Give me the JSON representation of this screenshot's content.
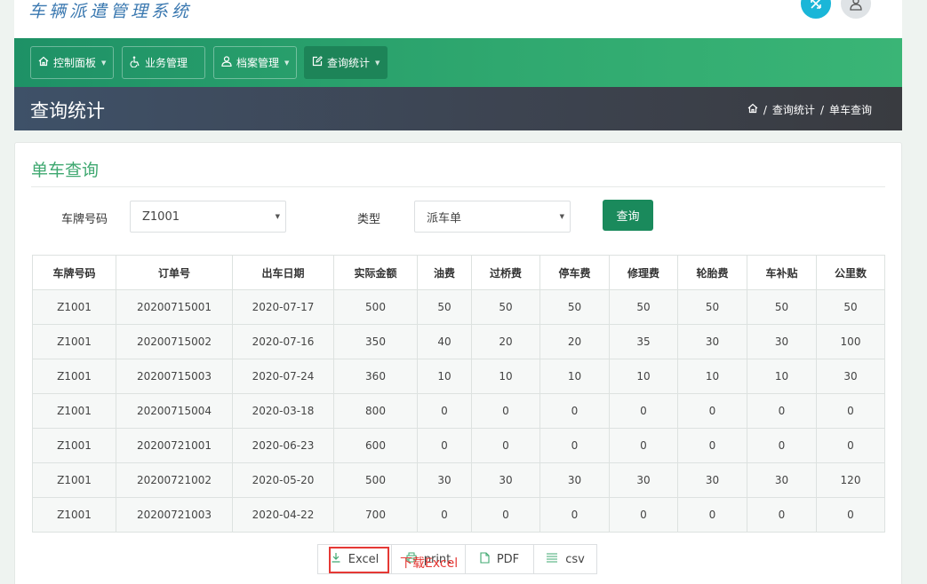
{
  "app": {
    "title": "车辆派遣管理系统"
  },
  "header_icons": [
    "expand-icon",
    "user-icon"
  ],
  "nav": {
    "items": [
      {
        "label": "控制面板",
        "icon": "home-icon",
        "has_caret": true
      },
      {
        "label": "业务管理",
        "icon": "wheelchair-icon",
        "has_caret": false
      },
      {
        "label": "档案管理",
        "icon": "user-outline-icon",
        "has_caret": true
      },
      {
        "label": "查询统计",
        "icon": "edit-icon",
        "has_caret": true,
        "active": true
      }
    ]
  },
  "page": {
    "title": "查询统计",
    "breadcrumb": [
      "查询统计",
      "单车查询"
    ],
    "breadcrumb_separator": "/"
  },
  "panel": {
    "title": "单车查询",
    "filters": {
      "plate_label": "车牌号码",
      "plate_value": "Z1001",
      "type_label": "类型",
      "type_value": "派车单",
      "query_button": "查询"
    }
  },
  "table": {
    "columns": [
      "车牌号码",
      "订单号",
      "出车日期",
      "实际金额",
      "油费",
      "过桥费",
      "停车费",
      "修理费",
      "轮胎费",
      "车补贴",
      "公里数"
    ],
    "rows": [
      [
        "Z1001",
        "20200715001",
        "2020-07-17",
        "500",
        "50",
        "50",
        "50",
        "50",
        "50",
        "50",
        "50"
      ],
      [
        "Z1001",
        "20200715002",
        "2020-07-16",
        "350",
        "40",
        "20",
        "20",
        "35",
        "30",
        "30",
        "100"
      ],
      [
        "Z1001",
        "20200715003",
        "2020-07-24",
        "360",
        "10",
        "10",
        "10",
        "10",
        "10",
        "10",
        "30"
      ],
      [
        "Z1001",
        "20200715004",
        "2020-03-18",
        "800",
        "0",
        "0",
        "0",
        "0",
        "0",
        "0",
        "0"
      ],
      [
        "Z1001",
        "20200721001",
        "2020-06-23",
        "600",
        "0",
        "0",
        "0",
        "0",
        "0",
        "0",
        "0"
      ],
      [
        "Z1001",
        "20200721002",
        "2020-05-20",
        "500",
        "30",
        "30",
        "30",
        "30",
        "30",
        "30",
        "120"
      ],
      [
        "Z1001",
        "20200721003",
        "2020-04-22",
        "700",
        "0",
        "0",
        "0",
        "0",
        "0",
        "0",
        "0"
      ]
    ]
  },
  "export": {
    "excel": "Excel",
    "print": "print",
    "pdf": "PDF",
    "csv": "csv"
  },
  "annotation": {
    "text": "下载Excel",
    "color": "#e53935"
  },
  "colors": {
    "nav_green": "#2fa86f",
    "title_dark": "#3d4451",
    "accent_green": "#3fa870",
    "query_btn": "#1a8a5c",
    "expand_icon_bg": "#1ab6d8"
  }
}
